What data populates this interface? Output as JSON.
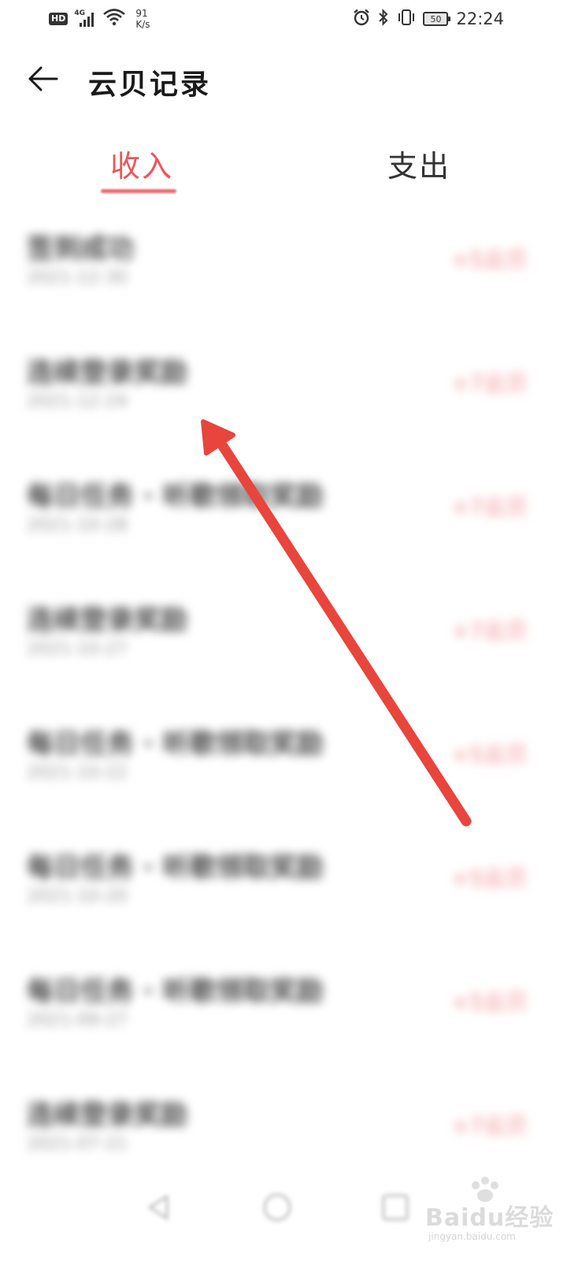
{
  "status_bar": {
    "hd_label": "HD",
    "network_label": "4G",
    "net_speed_value": "91",
    "net_speed_unit": "K/s",
    "battery_level": "50",
    "time": "22:24",
    "icons": [
      "hd-badge",
      "signal-icon",
      "wifi-icon",
      "alarm-icon",
      "bluetooth-icon",
      "vibrate-icon",
      "battery-icon"
    ]
  },
  "header": {
    "title": "云贝记录",
    "back_icon": "arrow-left-icon"
  },
  "tabs": [
    {
      "label": "收入",
      "active": true
    },
    {
      "label": "支出",
      "active": false
    }
  ],
  "colors": {
    "accent": "#e8585c",
    "amount": "#f08a8c",
    "arrow": "#e8453c"
  },
  "records": [
    {
      "title": "签到成功",
      "date": "2021-12-30",
      "amount": "+5云贝"
    },
    {
      "title": "连续登录奖励",
      "date": "2021-12-24",
      "amount": "+7云贝"
    },
    {
      "title": "每日任务 · 听歌领取奖励",
      "date": "2021-10-28",
      "amount": "+7云贝"
    },
    {
      "title": "连续登录奖励",
      "date": "2021-10-27",
      "amount": "+7云贝"
    },
    {
      "title": "每日任务 · 听歌领取奖励",
      "date": "2021-10-22",
      "amount": "+5云贝"
    },
    {
      "title": "每日任务 · 听歌领取奖励",
      "date": "2021-10-20",
      "amount": "+5云贝"
    },
    {
      "title": "每日任务 · 听歌领取奖励",
      "date": "2021-09-27",
      "amount": "+5云贝"
    },
    {
      "title": "连续登录奖励",
      "date": "2021-07-21",
      "amount": "+7云贝"
    }
  ],
  "nav_bar": {
    "icons": [
      "nav-back-icon",
      "nav-home-icon",
      "nav-recents-icon"
    ]
  },
  "watermark": {
    "text": "Baidu经验",
    "sub": "jingyan.baidu.com"
  }
}
